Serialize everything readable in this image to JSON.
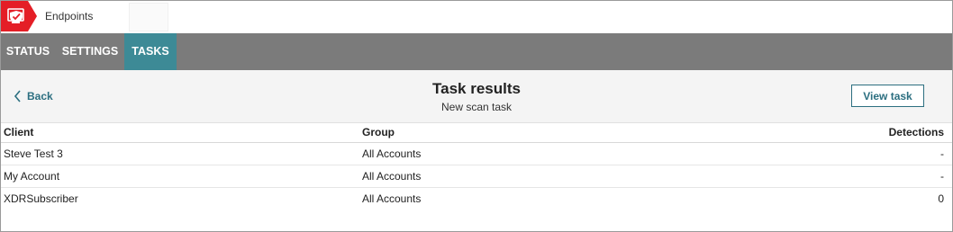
{
  "app": {
    "title": "Endpoints",
    "brand_color": "#e41e26"
  },
  "tabs": [
    {
      "label": "STATUS",
      "active": false
    },
    {
      "label": "SETTINGS",
      "active": false
    },
    {
      "label": "TASKS",
      "active": true
    }
  ],
  "header": {
    "back_label": "Back",
    "title": "Task results",
    "subtitle": "New scan task",
    "view_task_label": "View task"
  },
  "table": {
    "columns": [
      "Client",
      "Group",
      "Detections"
    ],
    "rows": [
      {
        "client": "Steve Test 3",
        "group": "All Accounts",
        "detections": "-"
      },
      {
        "client": "My Account",
        "group": "All Accounts",
        "detections": "-"
      },
      {
        "client": "XDRSubscriber",
        "group": "All Accounts",
        "detections": "0"
      }
    ]
  },
  "colors": {
    "tab_bar": "#7b7b7b",
    "tab_active": "#3d8a96",
    "link": "#2c6f80"
  }
}
